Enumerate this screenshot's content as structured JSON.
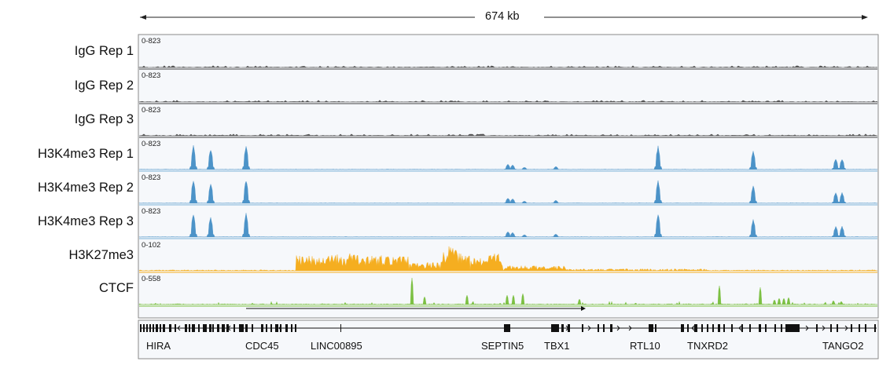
{
  "scale": {
    "label": "674 kb"
  },
  "colors": {
    "igg": "#555555",
    "h3k4me3": "#4c93c8",
    "h3k4me3_line": "#7fb3da",
    "h3k27me3": "#f5ae20",
    "ctcf": "#7cc043",
    "panel_bg": "#f6f8fb",
    "border": "#8a8a8a",
    "gene": "#111111"
  },
  "tracks": [
    {
      "id": "igg1",
      "name": "IgG Rep 1",
      "range": "0-823",
      "kind": "igg"
    },
    {
      "id": "igg2",
      "name": "IgG Rep 2",
      "range": "0-823",
      "kind": "igg"
    },
    {
      "id": "igg3",
      "name": "IgG Rep 3",
      "range": "0-823",
      "kind": "igg"
    },
    {
      "id": "h3k4me3_1",
      "name": "H3K4me3 Rep 1",
      "range": "0-823",
      "kind": "h3k4me3"
    },
    {
      "id": "h3k4me3_2",
      "name": "H3K4me3 Rep 2",
      "range": "0-823",
      "kind": "h3k4me3"
    },
    {
      "id": "h3k4me3_3",
      "name": "H3K4me3 Rep 3",
      "range": "0-823",
      "kind": "h3k4me3"
    },
    {
      "id": "h3k27me3",
      "name": "H3K27me3",
      "range": "0-102",
      "kind": "h3k27me3"
    },
    {
      "id": "ctcf",
      "name": "CTCF",
      "range": "0-558",
      "kind": "ctcf"
    }
  ],
  "genes": [
    {
      "name": "HIRA"
    },
    {
      "name": "CDC45"
    },
    {
      "name": "LINC00895"
    },
    {
      "name": "SEPTIN5"
    },
    {
      "name": "TBX1"
    },
    {
      "name": "RTL10"
    },
    {
      "name": "TNXRD2"
    },
    {
      "name": "TANGO2"
    }
  ]
}
